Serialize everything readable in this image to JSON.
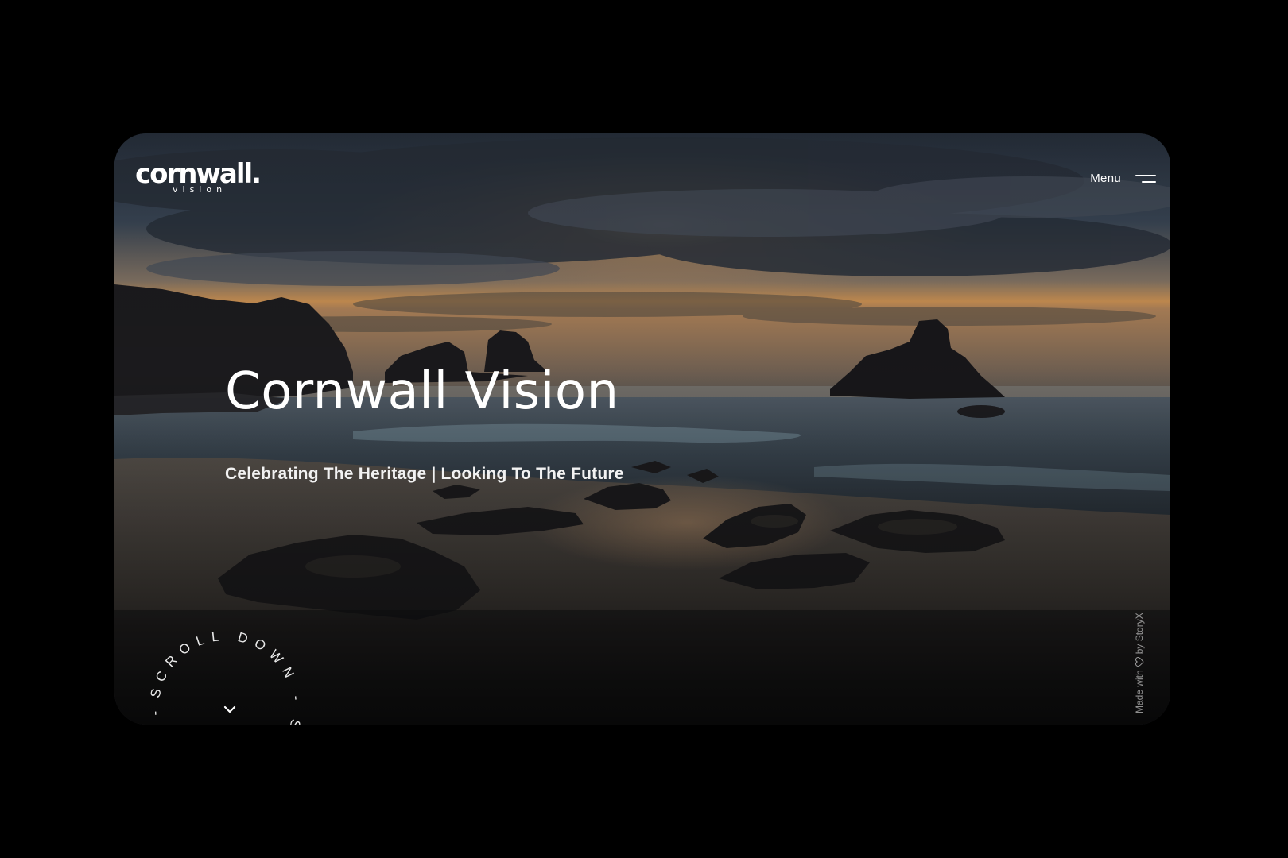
{
  "header": {
    "logo_word": "cornwall.",
    "logo_sub": "vision",
    "menu_label": "Menu"
  },
  "hero": {
    "title": "Cornwall Vision",
    "subtitle": "Celebrating The Heritage | Looking To The Future"
  },
  "scroll": {
    "label": "SCROLL DOWN - SCROLL DOWN - "
  },
  "credit": {
    "prefix": "Made with",
    "suffix": "by StoryX"
  },
  "icons": {
    "menu": "hamburger-icon",
    "scroll": "chevron-down-icon",
    "credit": "heart-icon"
  },
  "colors": {
    "page_background": "#000000",
    "text": "#ffffff",
    "sunset": "#e8a25a"
  }
}
